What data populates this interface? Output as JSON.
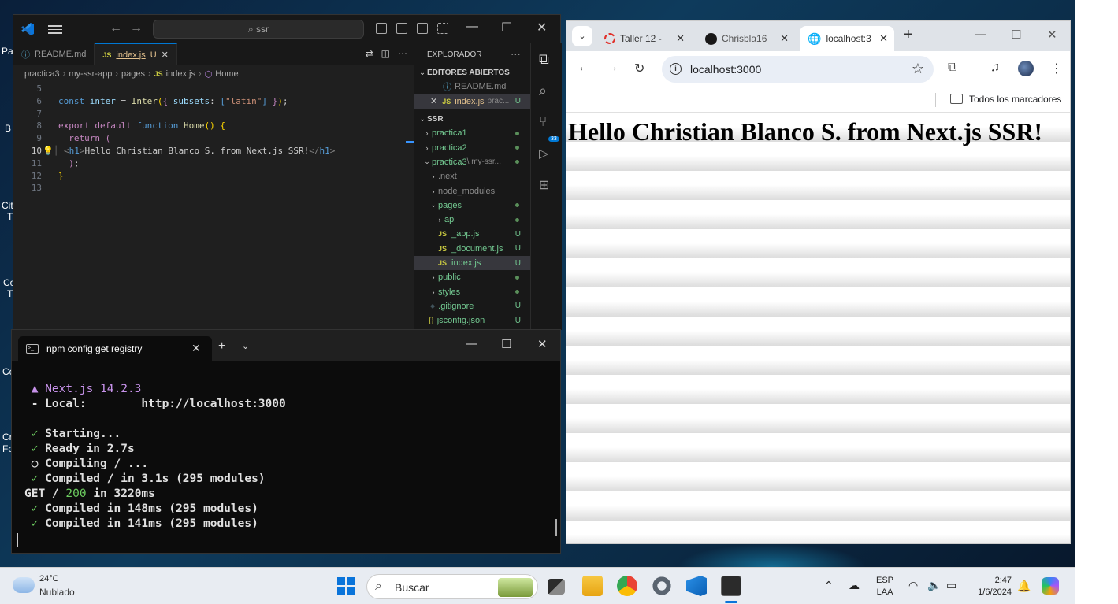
{
  "desktop": {
    "labels": [
      "Pa",
      "B",
      "Cit",
      "Ti",
      "Co",
      "Ti",
      "Co",
      "Cr",
      "Fo"
    ]
  },
  "vscode": {
    "search_placeholder": "ssr",
    "tabs": [
      {
        "label": "README.md",
        "icon": "markdown-info-icon",
        "active": false
      },
      {
        "label": "index.js",
        "status": "U",
        "icon": "js-icon",
        "active": true
      }
    ],
    "breadcrumb": [
      "practica3",
      "my-ssr-app",
      "pages",
      "index.js",
      "Home"
    ],
    "code_lines": [
      {
        "n": "5",
        "text": ""
      },
      {
        "n": "6",
        "text": "const inter = Inter({ subsets: [\"latin\"] });"
      },
      {
        "n": "7",
        "text": ""
      },
      {
        "n": "8",
        "text": "export default function Home() {"
      },
      {
        "n": "9",
        "text": "  return ("
      },
      {
        "n": "10",
        "text": "    <h1>Hello Christian Blanco S. from Next.js SSR!</h1>"
      },
      {
        "n": "11",
        "text": "  );"
      },
      {
        "n": "12",
        "text": "}"
      },
      {
        "n": "13",
        "text": ""
      }
    ],
    "sidebar": {
      "title": "EXPLORADOR",
      "open_editors_title": "EDITORES ABIERTOS",
      "open_editors": [
        {
          "label": "README.md",
          "suffix": ""
        },
        {
          "label": "index.js",
          "suffix": "prac...",
          "status": "U"
        }
      ],
      "workspace_title": "SSR",
      "tree": [
        {
          "label": "practica1",
          "type": "folder",
          "indent": 1
        },
        {
          "label": "practica2",
          "type": "folder",
          "indent": 1
        },
        {
          "label": "practica3",
          "sub": "\\ my-ssr...",
          "type": "folder-open",
          "indent": 1
        },
        {
          "label": ".next",
          "type": "folder",
          "indent": 2
        },
        {
          "label": "node_modules",
          "type": "folder",
          "indent": 2
        },
        {
          "label": "pages",
          "type": "folder-open",
          "indent": 2
        },
        {
          "label": "api",
          "type": "folder",
          "indent": 3
        },
        {
          "label": "_app.js",
          "type": "js",
          "status": "U",
          "indent": 3
        },
        {
          "label": "_document.js",
          "type": "js",
          "status": "U",
          "indent": 3
        },
        {
          "label": "index.js",
          "type": "js",
          "status": "U",
          "indent": 3,
          "selected": true
        },
        {
          "label": "public",
          "type": "folder",
          "indent": 2
        },
        {
          "label": "styles",
          "type": "folder",
          "indent": 2
        },
        {
          "label": ".gitignore",
          "type": "gitignore",
          "status": "U",
          "indent": 2
        },
        {
          "label": "jsconfig.json",
          "type": "json",
          "status": "U",
          "indent": 2
        }
      ]
    },
    "scm_badge": "33"
  },
  "terminal": {
    "tab_title": "npm config get registry",
    "lines": [
      {
        "parts": [
          {
            "t": " ▲ Next.js 14.2.3",
            "c": "t-magenta"
          }
        ]
      },
      {
        "parts": [
          {
            "t": " - Local:        http://localhost:3000",
            "c": "t-bold"
          }
        ]
      },
      {
        "parts": [
          {
            "t": "",
            "c": ""
          }
        ]
      },
      {
        "parts": [
          {
            "t": " ✓",
            "c": "t-green"
          },
          {
            "t": " Starting...",
            "c": "t-bold"
          }
        ]
      },
      {
        "parts": [
          {
            "t": " ✓",
            "c": "t-green"
          },
          {
            "t": " Ready in 2.7s",
            "c": "t-bold"
          }
        ]
      },
      {
        "parts": [
          {
            "t": " ○ Compiling / ...",
            "c": "t-bold"
          }
        ]
      },
      {
        "parts": [
          {
            "t": " ✓",
            "c": "t-green"
          },
          {
            "t": " Compiled / in 3.1s (295 modules)",
            "c": "t-bold"
          }
        ]
      },
      {
        "parts": [
          {
            "t": "GET / ",
            "c": "t-bold"
          },
          {
            "t": "200",
            "c": "t-green"
          },
          {
            "t": " in 3220ms",
            "c": "t-bold"
          }
        ]
      },
      {
        "parts": [
          {
            "t": " ✓",
            "c": "t-green"
          },
          {
            "t": " Compiled in 148ms (295 modules)",
            "c": "t-bold"
          }
        ]
      },
      {
        "parts": [
          {
            "t": " ✓",
            "c": "t-green"
          },
          {
            "t": " Compiled in 141ms (295 modules)",
            "c": "t-bold"
          }
        ]
      }
    ]
  },
  "chrome": {
    "tabs": [
      {
        "label": "Taller 12 -",
        "icon": "red-ring-icon"
      },
      {
        "label": "Chrisbla16",
        "icon": "github-icon"
      },
      {
        "label": "localhost:3",
        "icon": "globe-icon",
        "active": true
      }
    ],
    "url": "localhost:3000",
    "bookmarks_label": "Todos los marcadores",
    "page_heading": "Hello Christian Blanco S. from Next.js SSR!"
  },
  "taskbar": {
    "weather_temp": "24°C",
    "weather_desc": "Nublado",
    "search_label": "Buscar",
    "lang_line1": "ESP",
    "lang_line2": "LAA",
    "time": "2:47",
    "date": "1/6/2024",
    "accent": "#0a74da"
  }
}
